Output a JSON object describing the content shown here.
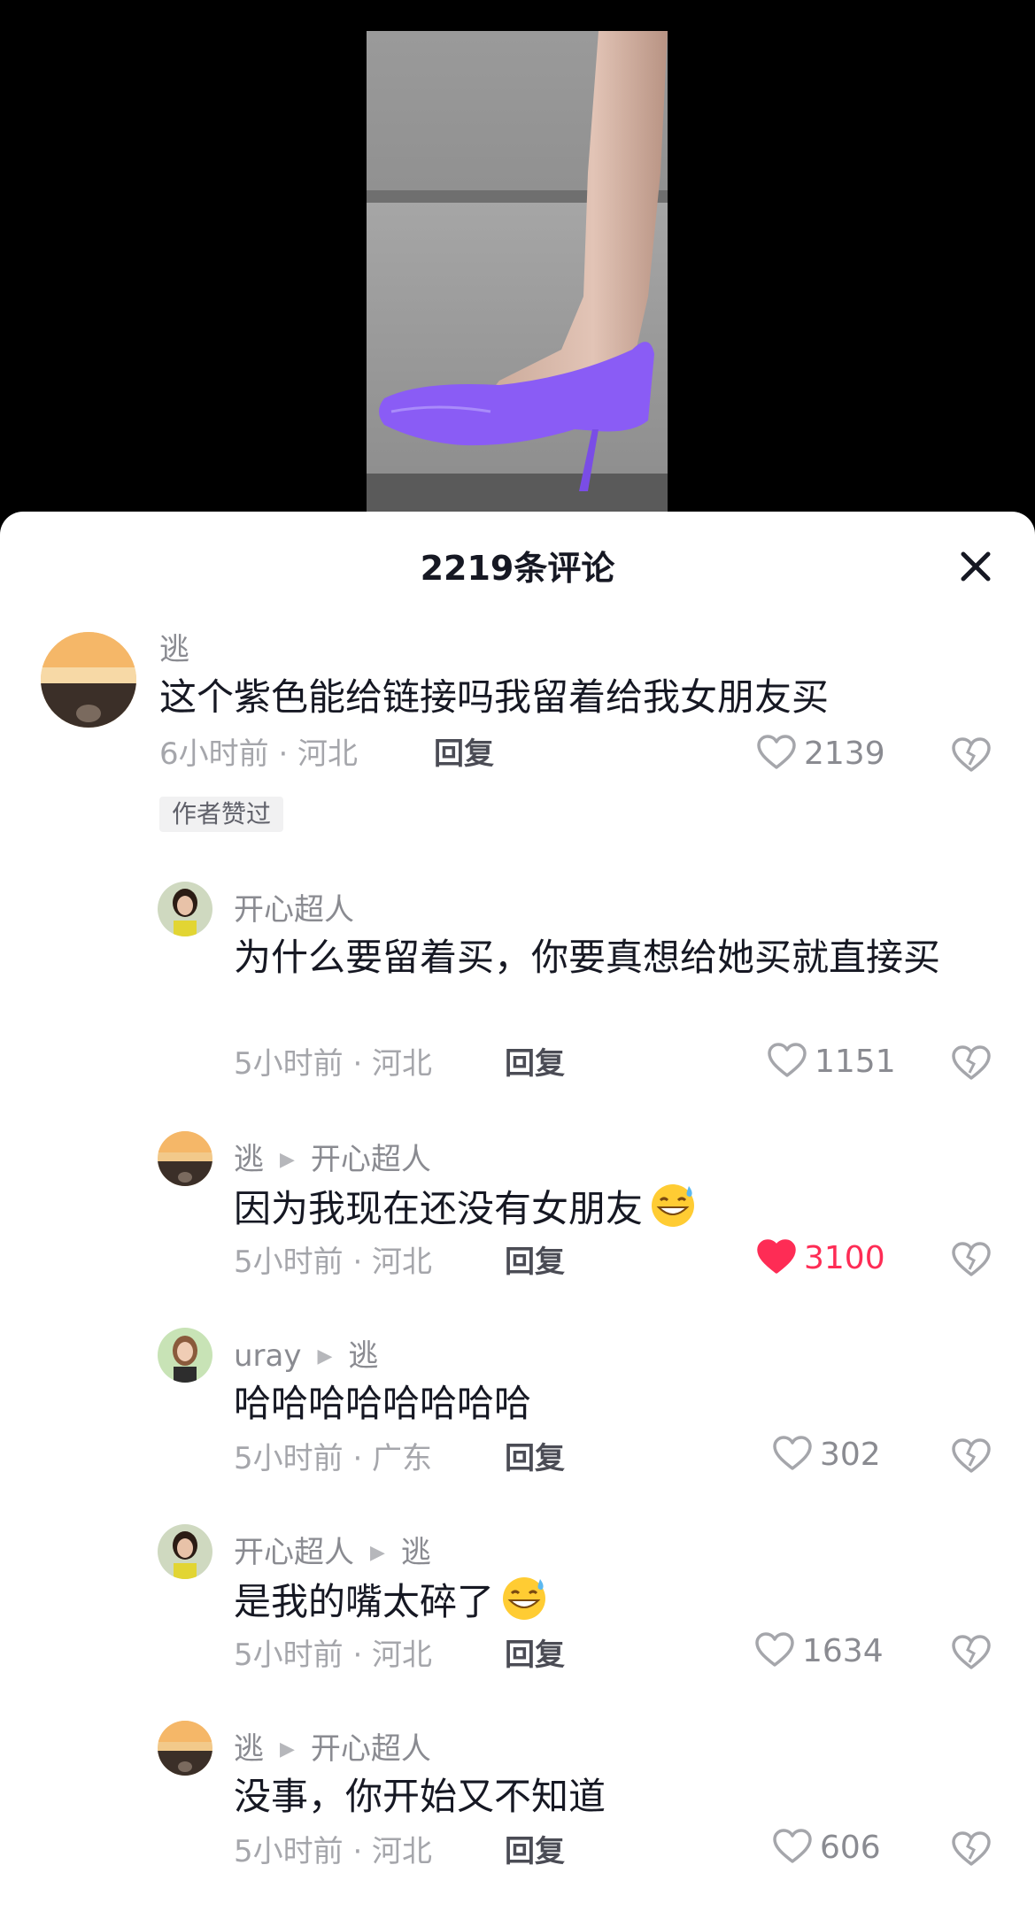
{
  "sheet": {
    "title": "2219条评论"
  },
  "icons": {
    "close": "close-icon",
    "like": "heart-icon",
    "dislike": "broken-heart-icon",
    "arrow": "triangle-right-icon"
  },
  "colors": {
    "like_active": "#fe2c55",
    "muted": "#a5a6ab",
    "shoe": "#8a5cf5"
  },
  "comments": [
    {
      "user": "逃",
      "text": "这个紫色能给链接吗我留着给我女朋友买",
      "meta": "6小时前 · 河北",
      "reply": "回复",
      "likes": "2139",
      "liked": false,
      "tag": "作者赞过"
    },
    {
      "user": "开心超人",
      "text": "为什么要留着买，你要真想给她买就直接买",
      "meta": "5小时前 · 河北",
      "reply": "回复",
      "likes": "1151",
      "liked": false
    },
    {
      "user": "逃",
      "reply_to": "开心超人",
      "text": "因为我现在还没有女朋友",
      "emoji": "grinning-sweat-emoji",
      "meta": "5小时前 · 河北",
      "reply": "回复",
      "likes": "3100",
      "liked": true
    },
    {
      "user": "uray",
      "reply_to": "逃",
      "text": "哈哈哈哈哈哈哈哈",
      "meta": "5小时前 · 广东",
      "reply": "回复",
      "likes": "302",
      "liked": false
    },
    {
      "user": "开心超人",
      "reply_to": "逃",
      "text": "是我的嘴太碎了",
      "emoji": "grinning-sweat-emoji",
      "meta": "5小时前 · 河北",
      "reply": "回复",
      "likes": "1634",
      "liked": false
    },
    {
      "user": "逃",
      "reply_to": "开心超人",
      "text": "没事，你开始又不知道",
      "meta": "5小时前 · 河北",
      "reply": "回复",
      "likes": "606",
      "liked": false
    }
  ]
}
